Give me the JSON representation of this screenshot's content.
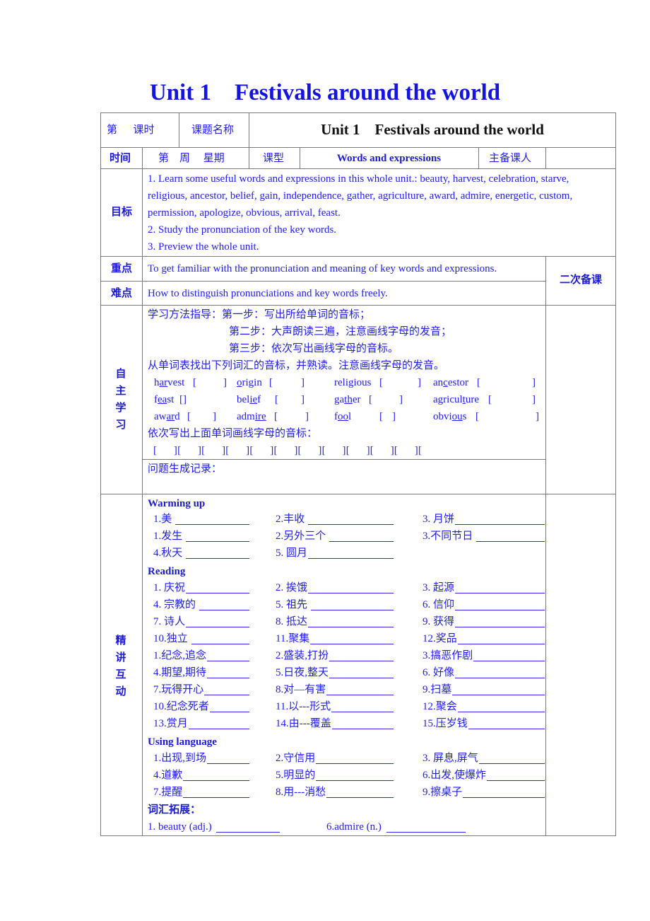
{
  "page_title": "Unit 1    Festivals around the world",
  "header_row": {
    "lesson_number_label": "第      课时",
    "topic_label": "课题名称",
    "topic_value": "Unit 1    Festivals around the world"
  },
  "time_row": {
    "time_label": "时间",
    "week_day": "第    周     星期",
    "type_label": "课型",
    "type_value": "Words and expressions",
    "teacher_label": "主备课人",
    "teacher_value": ""
  },
  "objectives": {
    "label": "目标",
    "lines": [
      "1. Learn some useful words and expressions in this whole unit.: beauty, harvest, celebration, starve,",
      "religious, ancestor, belief, gain, independence, gather, agriculture, award, admire, energetic, custom,",
      "permission, apologize, obvious, arrival, feast.",
      "2. Study the pronunciation of the key words.",
      "3. Preview the whole unit."
    ]
  },
  "key_points": {
    "label": "重点",
    "text": "To get familiar with the pronunciation and meaning of key words and expressions."
  },
  "difficulties": {
    "label": "难点",
    "text": "How to distinguish pronunciations and key words freely."
  },
  "second_prep_label": "二次备课",
  "self_study": {
    "label_chars": [
      "自",
      "主",
      "学",
      "习"
    ],
    "guide_line_1": "学习方法指导：第一步：写出所给单词的音标；",
    "guide_line_2": "第二步：大声朗读三遍，注意画线字母的发音；",
    "guide_line_3": "第三步：依次写出画线字母的音标。",
    "instruction": "从单词表找出下列词汇的音标，并熟读。注意画线字母的发音。",
    "words": [
      [
        {
          "pre": "h",
          "u": "ar",
          "post": "vest"
        },
        {
          "pre": "",
          "u": "o",
          "post": "rigin"
        },
        {
          "pre": "reli",
          "u": "g",
          "post": "ious"
        },
        {
          "pre": "an",
          "u": "c",
          "post": "estor"
        }
      ],
      [
        {
          "pre": "f",
          "u": "ea",
          "post": "st"
        },
        {
          "pre": "bel",
          "u": "ie",
          "post": "f"
        },
        {
          "pre": "ga",
          "u": "th",
          "post": "er"
        },
        {
          "pre": "agricul",
          "u": "t",
          "post": "ure"
        }
      ],
      [
        {
          "pre": "aw",
          "u": "ar",
          "post": "d"
        },
        {
          "pre": "adm",
          "u": "ire",
          "post": ""
        },
        {
          "pre": "f",
          "u": "oo",
          "post": "l"
        },
        {
          "pre": "obvi",
          "u": "ou",
          "post": "s"
        }
      ]
    ],
    "bracket_open": "[",
    "bracket_close": "]",
    "phonetic_instruction": "依次写出上面单词画线字母的音标：",
    "phonetic_slots": "[      ][      ][      ][      ][      ][      ][      ][      ][      ][      ][      ][",
    "question_record_label": "问题生成记录："
  },
  "intensive": {
    "label_chars": [
      "精",
      "讲",
      "互",
      "动"
    ],
    "warming_up": {
      "heading": "Warming up",
      "rows": [
        [
          "1.美 ",
          "2.丰收 ",
          "3. 月饼"
        ],
        [
          "1.发生 ",
          "2.另外三个 ",
          "3.不同节日 "
        ],
        [
          "4.秋天 ",
          "5. 圆月",
          ""
        ]
      ]
    },
    "reading": {
      "heading": "Reading",
      "rows": [
        [
          "1. 庆祝",
          "2. 挨饿",
          "3. 起源"
        ],
        [
          "4. 宗教的 ",
          "5. 祖先 ",
          "6. 信仰"
        ],
        [
          "7. 诗人",
          "8. 抵达",
          "9. 获得"
        ],
        [
          "10.独立 ",
          "11.聚集",
          "12.奖品"
        ],
        [
          "1.纪念,追念",
          "2.盛装,打扮",
          "3.搞恶作剧"
        ],
        [
          "4.期望,期待",
          "5.日夜,整天",
          "6. 好像"
        ],
        [
          "7.玩得开心",
          "8.对—有害",
          "9.扫墓"
        ],
        [
          "10.纪念死者",
          "11.以---形式",
          "12.聚会"
        ],
        [
          "13.赏月",
          "14.由---覆盖",
          "15.压岁钱"
        ]
      ]
    },
    "using_language": {
      "heading": "Using language",
      "rows": [
        [
          "1.出现,到场",
          "2.守信用",
          "3. 屏息,屏气"
        ],
        [
          "4.道歉",
          "5.明显的",
          "6.出发,使爆炸"
        ],
        [
          "7.提醒",
          "8.用---消愁",
          "9.擦桌子"
        ]
      ]
    },
    "vocab_extension": {
      "heading": "词汇拓展：",
      "items": [
        "1. beauty (adj.)",
        "6.admire (n.)"
      ]
    }
  }
}
